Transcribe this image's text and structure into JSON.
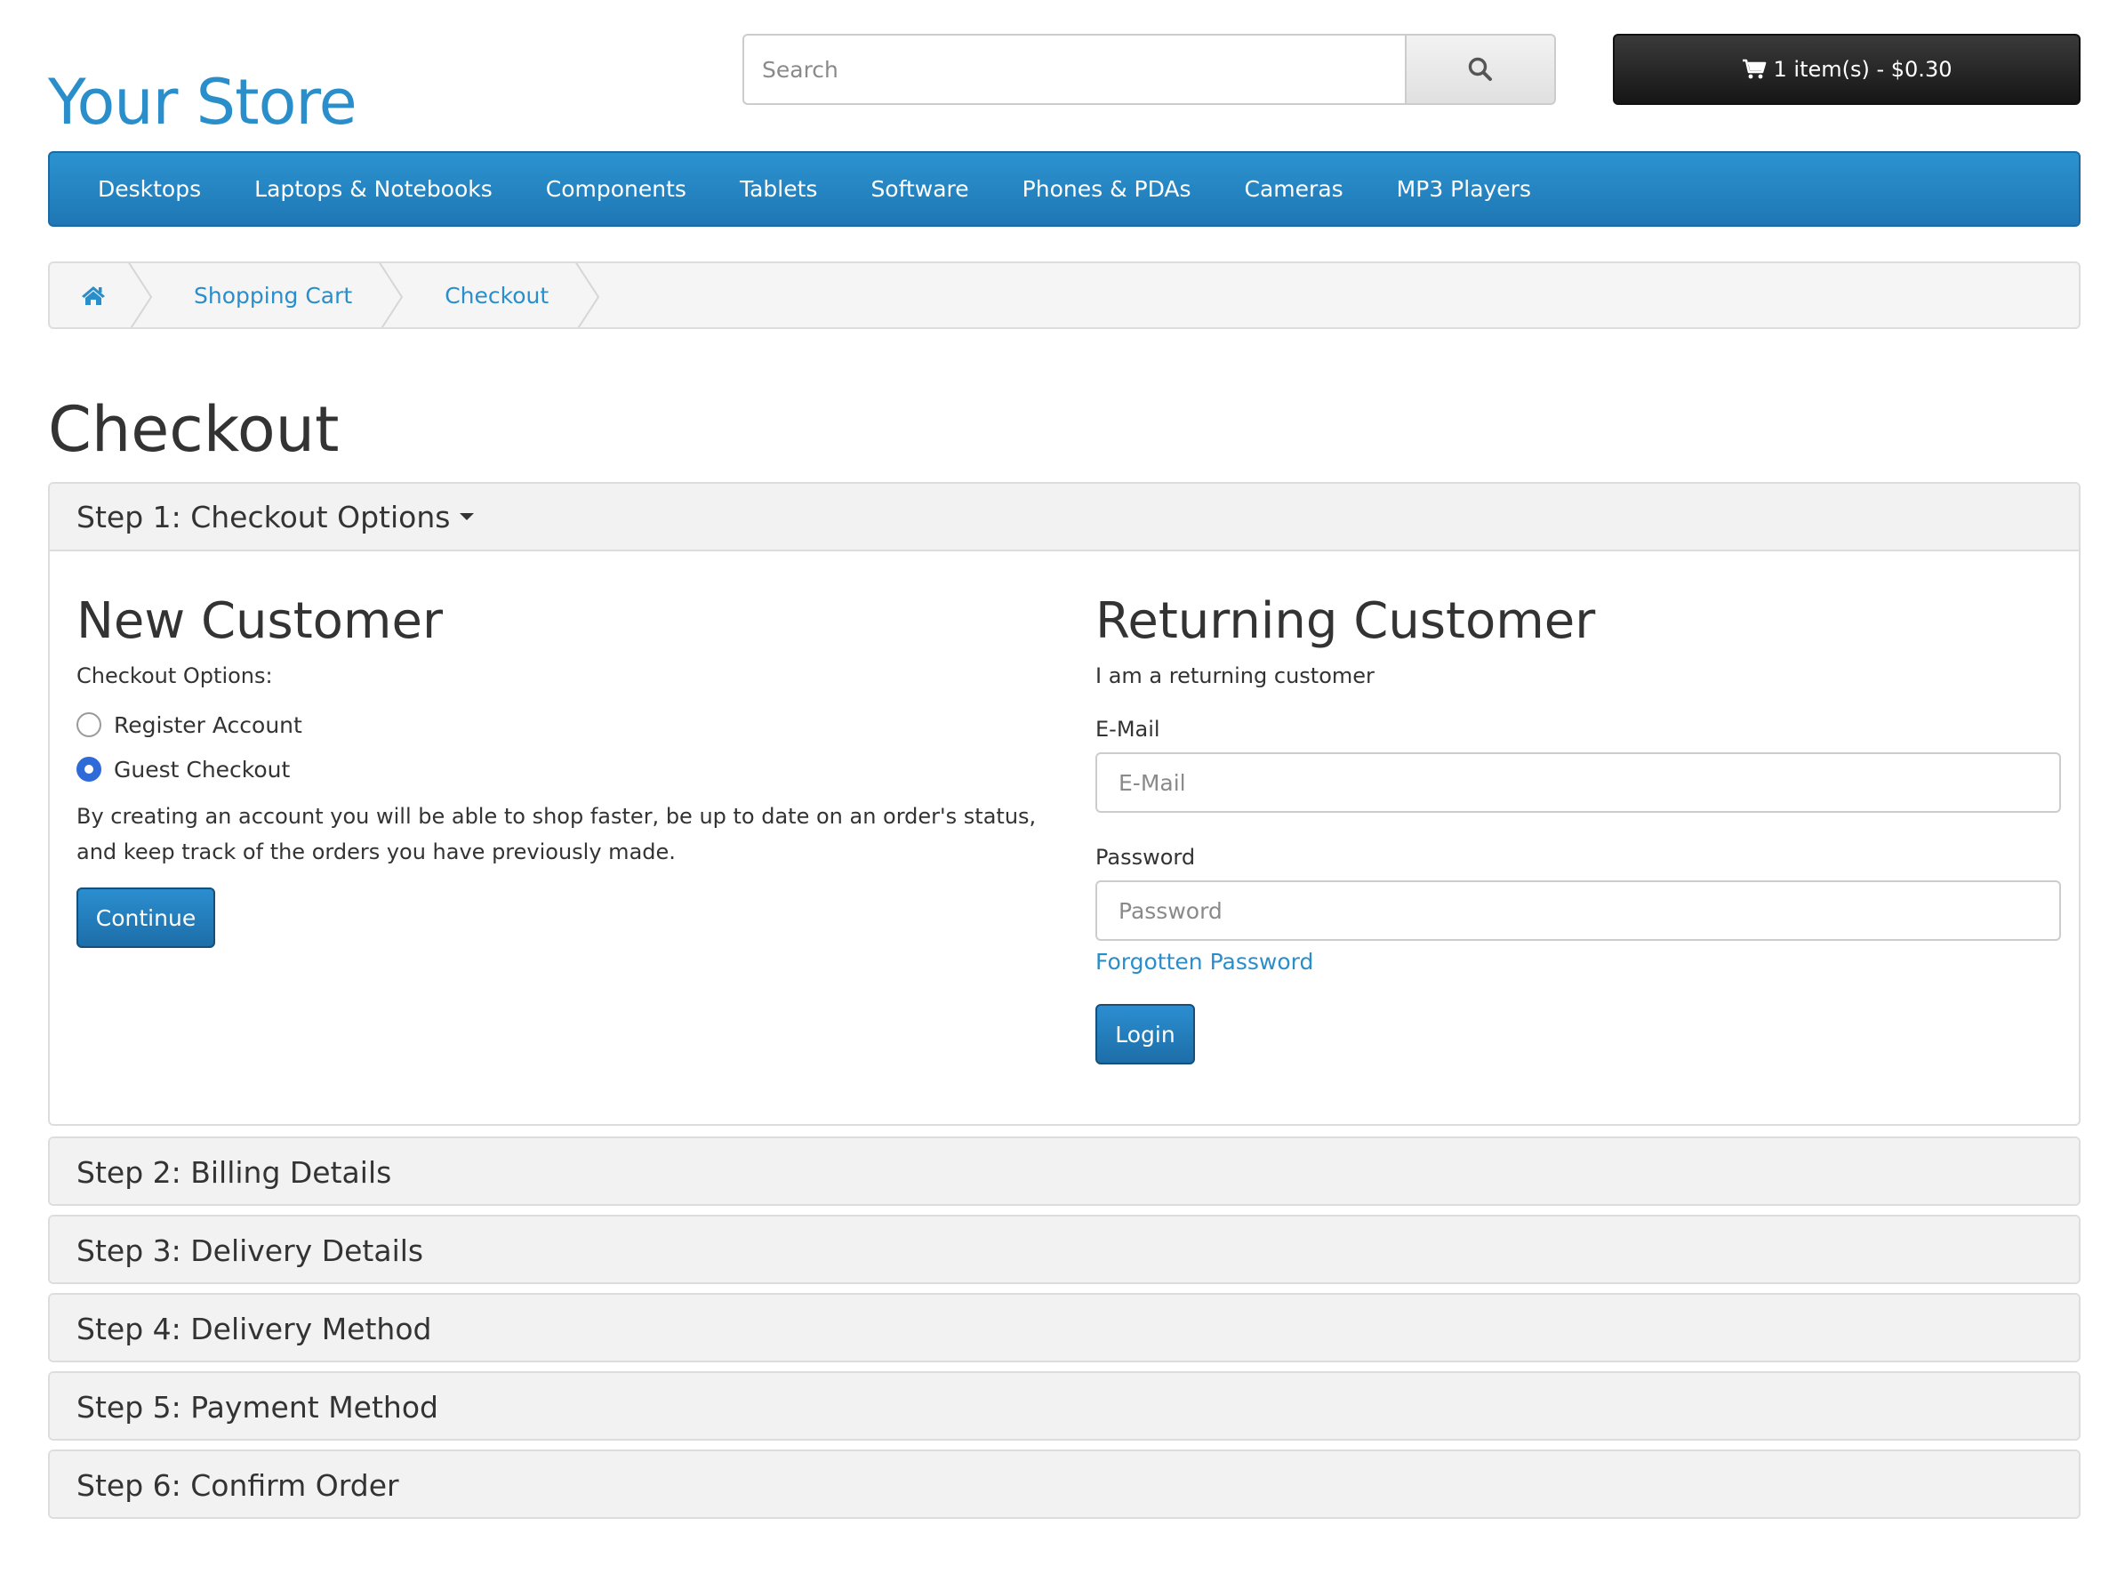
{
  "header": {
    "store_name": "Your Store",
    "search_placeholder": "Search",
    "search_icon": "search-icon",
    "cart_icon": "shopping-cart-icon",
    "cart_label": "1 item(s) - $0.30"
  },
  "menu": {
    "items": [
      {
        "label": "Desktops"
      },
      {
        "label": "Laptops & Notebooks"
      },
      {
        "label": "Components"
      },
      {
        "label": "Tablets"
      },
      {
        "label": "Software"
      },
      {
        "label": "Phones & PDAs"
      },
      {
        "label": "Cameras"
      },
      {
        "label": "MP3 Players"
      }
    ]
  },
  "breadcrumb": {
    "home_icon": "home-icon",
    "items": [
      {
        "label": "Shopping Cart"
      },
      {
        "label": "Checkout"
      }
    ]
  },
  "page": {
    "title": "Checkout"
  },
  "steps": [
    {
      "label": "Step 1: Checkout Options",
      "expanded": true
    },
    {
      "label": "Step 2: Billing Details",
      "expanded": false
    },
    {
      "label": "Step 3: Delivery Details",
      "expanded": false
    },
    {
      "label": "Step 4: Delivery Method",
      "expanded": false
    },
    {
      "label": "Step 5: Payment Method",
      "expanded": false
    },
    {
      "label": "Step 6: Confirm Order",
      "expanded": false
    }
  ],
  "new_customer": {
    "heading": "New Customer",
    "options_label": "Checkout Options:",
    "options": [
      {
        "label": "Register Account",
        "checked": false
      },
      {
        "label": "Guest Checkout",
        "checked": true
      }
    ],
    "description": "By creating an account you will be able to shop faster, be up to date on an order's status, and keep track of the orders you have previously made.",
    "continue_label": "Continue"
  },
  "returning_customer": {
    "heading": "Returning Customer",
    "subtitle": "I am a returning customer",
    "email_label": "E-Mail",
    "email_placeholder": "E-Mail",
    "email_value": "",
    "password_label": "Password",
    "password_placeholder": "Password",
    "password_value": "",
    "forgot_label": "Forgotten Password",
    "login_label": "Login"
  },
  "colors": {
    "accent": "#2a8ecb",
    "menu_bar": "#2384c4",
    "cart_button": "#222222",
    "radio_checked": "#2f6ad9"
  }
}
